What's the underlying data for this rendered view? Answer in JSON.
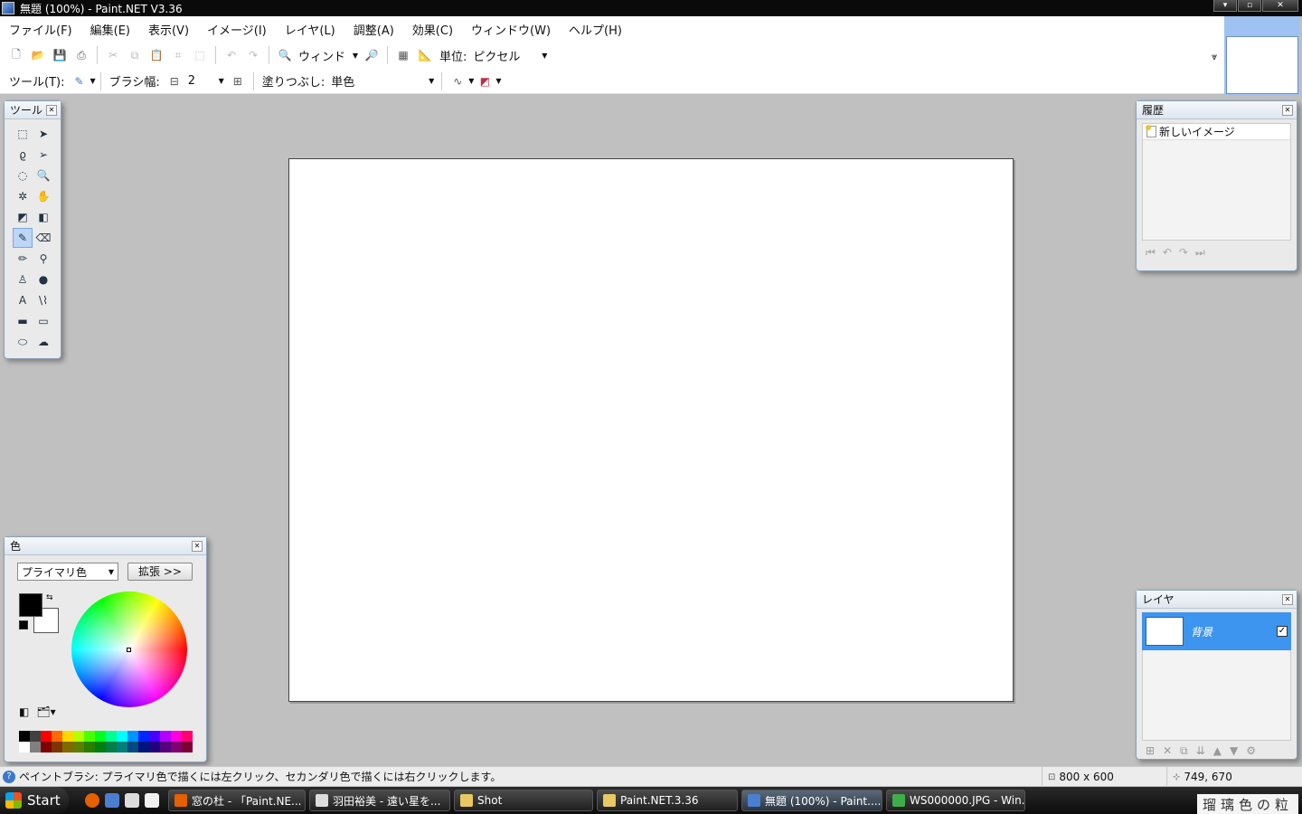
{
  "window": {
    "title": "無題 (100%) - Paint.NET V3.36",
    "buttons": [
      "▾",
      "▫",
      "✕"
    ]
  },
  "menu": [
    "ファイル(F)",
    "編集(E)",
    "表示(V)",
    "イメージ(I)",
    "レイヤ(L)",
    "調整(A)",
    "効果(C)",
    "ウィンドウ(W)",
    "ヘルプ(H)"
  ],
  "toolbar1": {
    "zoom_combo": "ウィンド",
    "unit_label": "単位:",
    "unit_value": "ピクセル"
  },
  "toolbar2": {
    "tool_label": "ツール(T):",
    "brush_width_label": "ブラシ幅:",
    "brush_width_value": "2",
    "fill_label": "塗りつぶし:",
    "fill_value": "単色"
  },
  "tools_panel": {
    "title": "ツール",
    "tools": [
      {
        "name": "rectangle-select",
        "glyph": "⬚"
      },
      {
        "name": "move-selected-pixels",
        "glyph": "➤"
      },
      {
        "name": "lasso-select",
        "glyph": "ϱ"
      },
      {
        "name": "move-selection",
        "glyph": "➢"
      },
      {
        "name": "ellipse-select",
        "glyph": "◌"
      },
      {
        "name": "zoom",
        "glyph": "🔍"
      },
      {
        "name": "magic-wand",
        "glyph": "✲"
      },
      {
        "name": "pan",
        "glyph": "✋"
      },
      {
        "name": "paint-bucket",
        "glyph": "◩"
      },
      {
        "name": "gradient",
        "glyph": "◧"
      },
      {
        "name": "paintbrush",
        "glyph": "✎"
      },
      {
        "name": "eraser",
        "glyph": "⌫"
      },
      {
        "name": "pencil",
        "glyph": "✏"
      },
      {
        "name": "color-picker",
        "glyph": "⚲"
      },
      {
        "name": "clone-stamp",
        "glyph": "♙"
      },
      {
        "name": "recolor",
        "glyph": "●"
      },
      {
        "name": "text",
        "glyph": "A"
      },
      {
        "name": "line-curve",
        "glyph": "\\⌇"
      },
      {
        "name": "rectangle",
        "glyph": "▬"
      },
      {
        "name": "rounded-rectangle",
        "glyph": "▭"
      },
      {
        "name": "ellipse",
        "glyph": "⬭"
      },
      {
        "name": "freeform-shape",
        "glyph": "☁"
      }
    ]
  },
  "history_panel": {
    "title": "履歴",
    "items": [
      "新しいイメージ"
    ]
  },
  "layers_panel": {
    "title": "レイヤ",
    "layers": [
      {
        "name": "背景",
        "visible": true
      }
    ]
  },
  "colors_panel": {
    "title": "色",
    "mode_select": "プライマリ色",
    "expand_button": "拡張 >>",
    "primary_color": "#000000",
    "secondary_color": "#ffffff",
    "palette": [
      "#000000",
      "#404040",
      "#ff0000",
      "#ff6a00",
      "#ffd800",
      "#b6ff00",
      "#4cff00",
      "#00ff21",
      "#00ff90",
      "#00ffff",
      "#0094ff",
      "#0026ff",
      "#4800ff",
      "#b200ff",
      "#ff00dc",
      "#ff006e",
      "#ffffff",
      "#808080",
      "#7f0000",
      "#7f3300",
      "#7f6a00",
      "#5b7f00",
      "#267f00",
      "#007f0e",
      "#007f46",
      "#007f7f",
      "#004a7f",
      "#00137f",
      "#21007f",
      "#57007f",
      "#7f006e",
      "#7f0037"
    ]
  },
  "status": {
    "hint": "ペイントブラシ: プライマリ色で描くには左クリック、セカンダリ色で描くには右クリックします。",
    "image_size": "800 x 600",
    "cursor_pos": "749, 670"
  },
  "taskbar": {
    "start": "Start",
    "tasks": [
      {
        "label": "窓の杜 - 「Paint.NE...",
        "color": "#e66000"
      },
      {
        "label": "羽田裕美 - 遠い星を...",
        "color": "#dddddd"
      },
      {
        "label": "Shot",
        "color": "#e8c860"
      },
      {
        "label": "Paint.NET.3.36",
        "color": "#e8c860"
      },
      {
        "label": "無題 (100%) - Paint....",
        "color": "#4a7fd0"
      },
      {
        "label": "WS000000.JPG - Win...",
        "color": "#3fae49"
      }
    ],
    "tray_text": "瑠璃色の粒"
  }
}
